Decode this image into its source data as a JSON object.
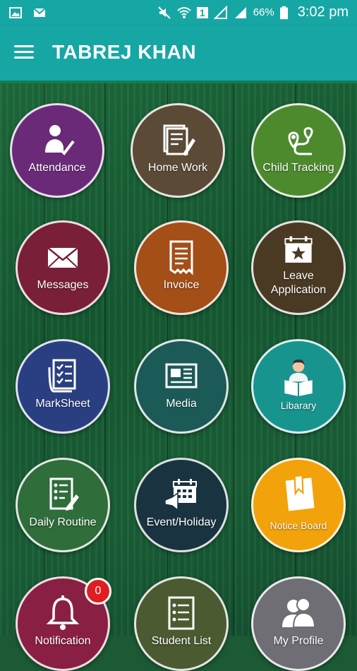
{
  "status_bar": {
    "battery": "66%",
    "time": "3:02 pm",
    "sim": "1"
  },
  "app_bar": {
    "title": "TABREJ KHAN"
  },
  "tiles": [
    {
      "label": "Attendance",
      "color": "#6b2a78"
    },
    {
      "label": "Home Work",
      "color": "#5a4a36"
    },
    {
      "label": "Child Tracking",
      "color": "#4d8a2e"
    },
    {
      "label": "Messages",
      "color": "#7a1f38"
    },
    {
      "label": "Invoice",
      "color": "#a44e18"
    },
    {
      "label": "Leave Application",
      "color": "#4a3a24"
    },
    {
      "label": "MarkSheet",
      "color": "#2a3f82"
    },
    {
      "label": "Media",
      "color": "#1c5a58"
    },
    {
      "label": "Libarary",
      "color": "#18948f"
    },
    {
      "label": "Daily Routine",
      "color": "#2f6d3a"
    },
    {
      "label": "Event/Holiday",
      "color": "#1a3340"
    },
    {
      "label": "Notice Board",
      "color": "#f2a20a"
    },
    {
      "label": "Notification",
      "color": "#8a1f44"
    },
    {
      "label": "Student List",
      "color": "#4b5a30"
    },
    {
      "label": "My Profile",
      "color": "#6e6e74"
    }
  ],
  "notification_badge": "0"
}
